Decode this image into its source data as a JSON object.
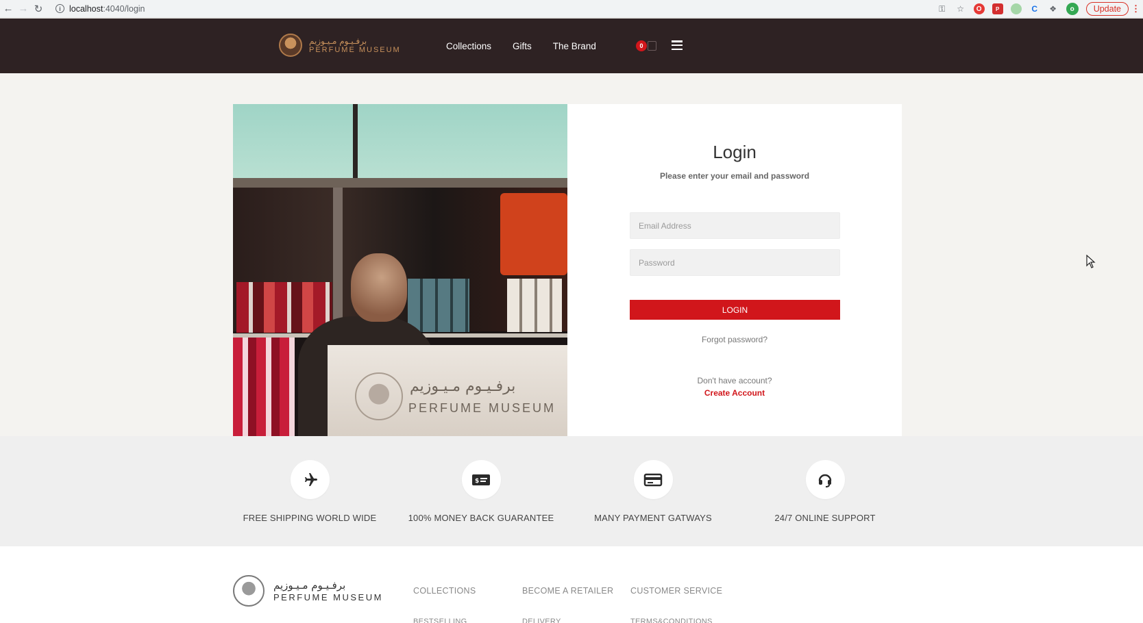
{
  "browser": {
    "url_host": "localhost",
    "url_path": ":4040/login",
    "info_icon": "i",
    "update_label": "Update"
  },
  "header": {
    "logo_ar": "برفـيـوم مـيـوزيم",
    "logo_en": "PERFUME MUSEUM",
    "nav": [
      {
        "label": "Collections"
      },
      {
        "label": "Gifts"
      },
      {
        "label": "The Brand"
      }
    ],
    "cart_count": "0"
  },
  "hero": {
    "counter_ar": "برفـيـوم مـيـوزيم",
    "counter_en": "PERFUME MUSEUM"
  },
  "login": {
    "title": "Login",
    "subtitle": "Please enter your email and password",
    "email_placeholder": "Email Address",
    "password_placeholder": "Password",
    "button_label": "LOGIN",
    "forgot_label": "Forgot password?",
    "no_account_text": "Don't have account?",
    "create_label": "Create Account"
  },
  "features": [
    {
      "label": "FREE SHIPPING WORLD WIDE",
      "icon": "airplane-icon"
    },
    {
      "label": "100% MONEY BACK GUARANTEE",
      "icon": "cash-icon"
    },
    {
      "label": "MANY PAYMENT GATWAYS",
      "icon": "credit-card-icon"
    },
    {
      "label": "24/7 ONLINE SUPPORT",
      "icon": "headset-icon"
    }
  ],
  "footer": {
    "logo_ar": "برفـيـوم مـيـوزيم",
    "logo_en": "PERFUME MUSEUM",
    "columns": [
      {
        "heading": "COLLECTIONS",
        "first_item": "BESTSELLING"
      },
      {
        "heading": "BECOME A RETAILER",
        "first_item": "DELIVERY"
      },
      {
        "heading": "CUSTOMER SERVICE",
        "first_item": "TERMS&CONDITIONS"
      }
    ]
  },
  "colors": {
    "header_bg": "#2e2223",
    "accent_red": "#d1161b",
    "logo_gold": "#c9925c",
    "page_bg": "#f4f3f0",
    "features_bg": "#efefef"
  }
}
